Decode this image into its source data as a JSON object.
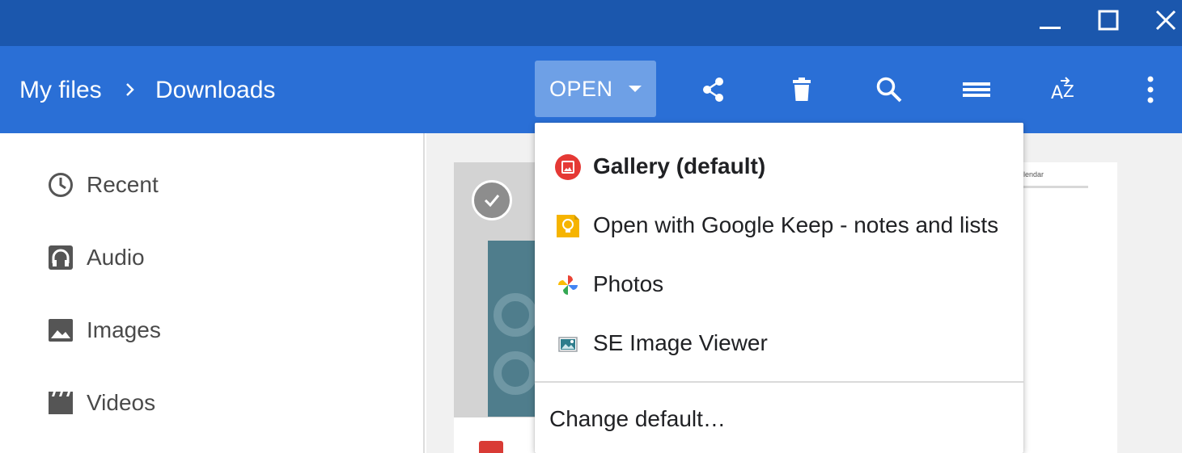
{
  "window": {
    "controls": [
      "minimize-icon",
      "maximize-icon",
      "close-icon"
    ]
  },
  "toolbar": {
    "breadcrumb": [
      "My files",
      "Downloads"
    ],
    "open_label": "OPEN",
    "icons": [
      "share-icon",
      "delete-icon",
      "search-icon",
      "list-view-icon",
      "sort-icon",
      "more-vert-icon"
    ]
  },
  "sidebar": {
    "items": [
      {
        "label": "Recent",
        "icon": "clock-icon"
      },
      {
        "label": "Audio",
        "icon": "headphones-icon"
      },
      {
        "label": "Images",
        "icon": "image-icon"
      },
      {
        "label": "Videos",
        "icon": "video-icon"
      }
    ]
  },
  "files": {
    "preview_text": "lendar"
  },
  "open_menu": {
    "items": [
      {
        "label": "Gallery (default)",
        "icon": "gallery-icon",
        "default": true
      },
      {
        "label": "Open with Google Keep - notes and lists",
        "icon": "keep-icon"
      },
      {
        "label": "Photos",
        "icon": "photos-icon"
      },
      {
        "label": "SE Image Viewer",
        "icon": "image-viewer-icon"
      }
    ],
    "change_default": "Change default…"
  },
  "colors": {
    "title_bar": "#1b57ad",
    "toolbar": "#2a6fd6",
    "open_button": "#6ea0e6",
    "gallery_red": "#e53935",
    "keep_yellow": "#f6b400"
  }
}
